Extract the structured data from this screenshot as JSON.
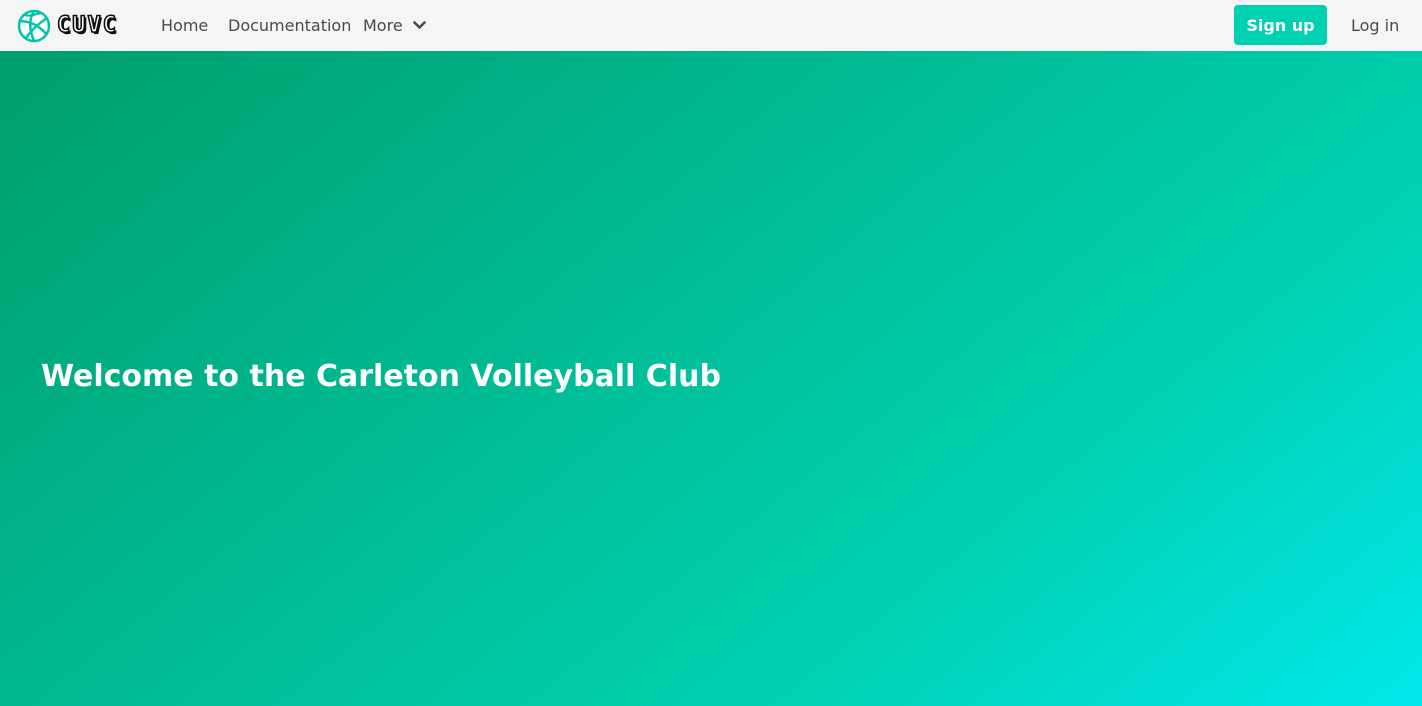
{
  "nav": {
    "brand_text": "CUVC",
    "brand_logo_icon": "volleyball-icon",
    "links": {
      "home": "Home",
      "documentation": "Documentation",
      "more": "More"
    },
    "more_icon": "chevron-down-icon",
    "signup_label": "Sign up",
    "login_label": "Log in"
  },
  "hero": {
    "title": "Welcome to the Carleton Volleyball Club"
  },
  "colors": {
    "navbar_bg": "#f5f5f5",
    "primary": "#00d1b2",
    "hero_gradient": [
      "#009e6c",
      "#00d1b2",
      "#00e7eb"
    ],
    "nav_text": "#4a4a4a"
  }
}
